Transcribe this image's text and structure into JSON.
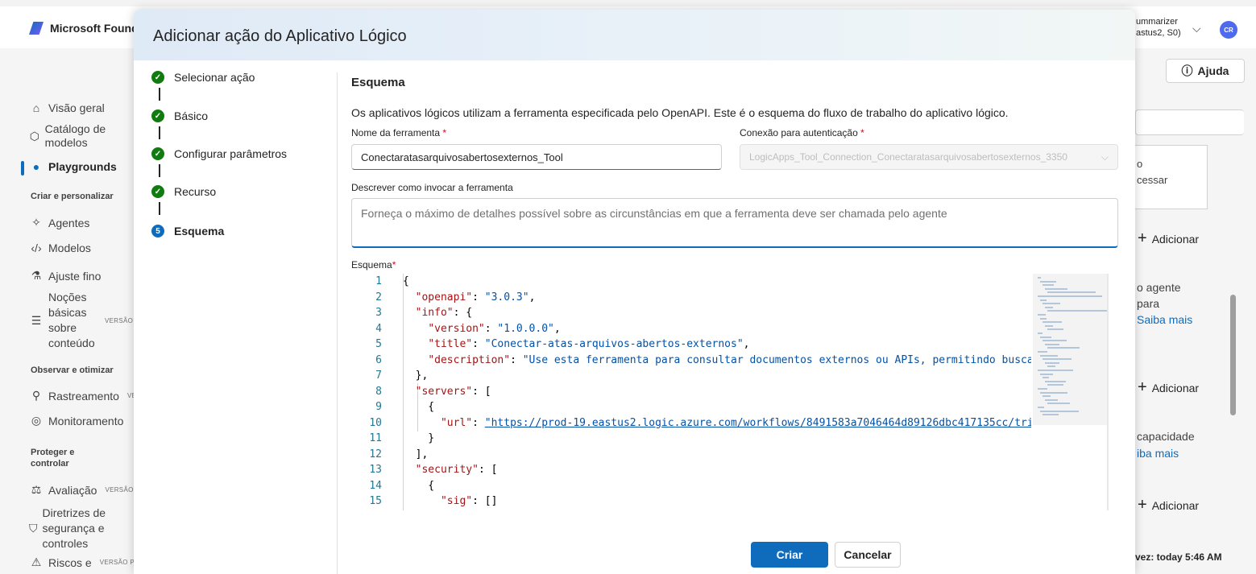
{
  "app": {
    "brand": "Microsoft Foundry",
    "user_name_partial": "ummarizer",
    "user_region_partial": "astus2, S0)",
    "avatar_initials": "CR",
    "help_label": "Ajuda"
  },
  "sidebar": {
    "items": [
      {
        "label": "Visão geral",
        "icon": "home-icon"
      },
      {
        "label": "Catálogo de modelos",
        "icon": "cube-icon"
      },
      {
        "label": "Playgrounds",
        "icon": "chat-icon"
      },
      {
        "label": "Agentes",
        "icon": "sparkle-icon"
      },
      {
        "label": "Modelos",
        "icon": "code-icon"
      },
      {
        "label": "Ajuste fino",
        "icon": "flask-icon"
      },
      {
        "label": "Noções básicas sobre conteúdo",
        "icon": "list-icon",
        "badge": "VERSÃO"
      },
      {
        "label": "Rastreamento",
        "icon": "trace-icon",
        "badge": "VE"
      },
      {
        "label": "Monitoramento",
        "icon": "monitor-icon"
      },
      {
        "label": "Avaliação",
        "icon": "eval-icon",
        "badge": "VERSÃO"
      },
      {
        "label": "Diretrizes de segurança e controles",
        "icon": "shield-icon"
      },
      {
        "label": "Riscos e",
        "icon": "risk-icon",
        "badge": "VERSÃO PR"
      }
    ],
    "sections": [
      "Criar e personalizar",
      "Observar e otimizar",
      "Proteger e controlar"
    ]
  },
  "right_panel": {
    "texts": [
      "o",
      "cessar",
      "o agente",
      "para",
      "Saiba mais",
      "capacidade",
      "iba mais",
      "vez: today 5:46 AM"
    ],
    "add_label": "Adicionar"
  },
  "modal": {
    "title": "Adicionar ação do Aplicativo Lógico",
    "steps": [
      {
        "label": "Selecionar ação",
        "state": "done"
      },
      {
        "label": "Básico",
        "state": "done"
      },
      {
        "label": "Configurar parâmetros",
        "state": "done"
      },
      {
        "label": "Recurso",
        "state": "done"
      },
      {
        "label": "Esquema",
        "state": "current",
        "number": "5"
      }
    ],
    "section_title": "Esquema",
    "section_desc": "Os aplicativos lógicos utilizam a ferramenta especificada pelo OpenAPI. Este é o esquema do fluxo de trabalho do aplicativo lógico.",
    "tool_name_label": "Nome da ferramenta",
    "tool_name_value": "Conectaratasarquivosabertosexternos_Tool",
    "connection_label": "Conexão para autenticação",
    "connection_value": "LogicApps_Tool_Connection_Conectaratasarquivosabertosexternos_3350",
    "describe_label": "Descrever como invocar a ferramenta",
    "describe_placeholder": "Forneça o máximo de detalhes possível sobre as circunstâncias em que a ferramenta deve ser chamada pelo agente",
    "schema_label": "Esquema",
    "required_marker": "*",
    "code_lines": [
      "{",
      "  \"openapi\": \"3.0.3\",",
      "  \"info\": {",
      "    \"version\": \"1.0.0.0\",",
      "    \"title\": \"Conectar-atas-arquivos-abertos-externos\",",
      "    \"description\": \"Use esta ferramenta para consultar documentos externos ou APIs, permitindo busca",
      "  },",
      "  \"servers\": [",
      "    {",
      "      \"url\": \"https://prod-19.eastus2.logic.azure.com/workflows/8491583a7046464d89126dbc417135cc/tri",
      "    }",
      "  ],",
      "  \"security\": [",
      "    {",
      "      \"sig\": []"
    ],
    "create_label": "Criar",
    "cancel_label": "Cancelar"
  }
}
